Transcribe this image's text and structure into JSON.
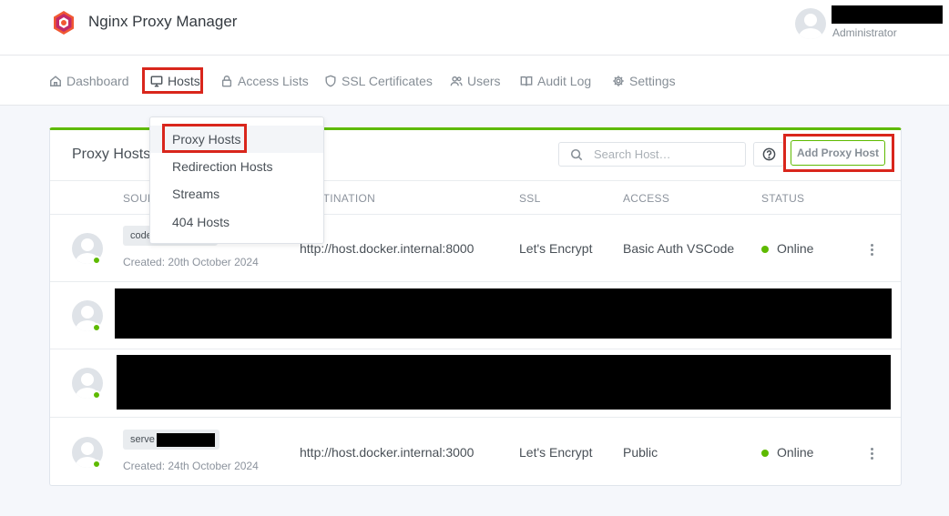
{
  "header": {
    "app_title": "Nginx Proxy Manager",
    "user_role": "Administrator"
  },
  "nav": {
    "items": [
      {
        "label": "Dashboard",
        "icon": "home-icon"
      },
      {
        "label": "Hosts",
        "icon": "monitor-icon",
        "active": true
      },
      {
        "label": "Access Lists",
        "icon": "lock-icon"
      },
      {
        "label": "SSL Certificates",
        "icon": "shield-icon"
      },
      {
        "label": "Users",
        "icon": "users-icon"
      },
      {
        "label": "Audit Log",
        "icon": "book-icon"
      },
      {
        "label": "Settings",
        "icon": "gear-icon"
      }
    ]
  },
  "hosts_menu": {
    "items": [
      "Proxy Hosts",
      "Redirection Hosts",
      "Streams",
      "404 Hosts"
    ],
    "active_index": 0
  },
  "card": {
    "title": "Proxy Hosts",
    "search_placeholder": "Search Host…",
    "add_button": "Add Proxy Host",
    "columns": [
      "SOURCE",
      "DESTINATION",
      "SSL",
      "ACCESS",
      "STATUS"
    ],
    "rows": [
      {
        "source": "code",
        "created": "Created: 20th October 2024",
        "destination": "http://host.docker.internal:8000",
        "ssl": "Let's Encrypt",
        "access": "Basic Auth VSCode",
        "status": "Online"
      },
      {
        "redacted": true
      },
      {
        "redacted": true
      },
      {
        "source": "serve",
        "created": "Created: 24th October 2024",
        "destination": "http://host.docker.internal:3000",
        "ssl": "Let's Encrypt",
        "access": "Public",
        "status": "Online"
      }
    ]
  },
  "colors": {
    "accent": "#5eba00",
    "highlight": "#d9261c",
    "text": "#495057",
    "muted": "#868e96"
  }
}
